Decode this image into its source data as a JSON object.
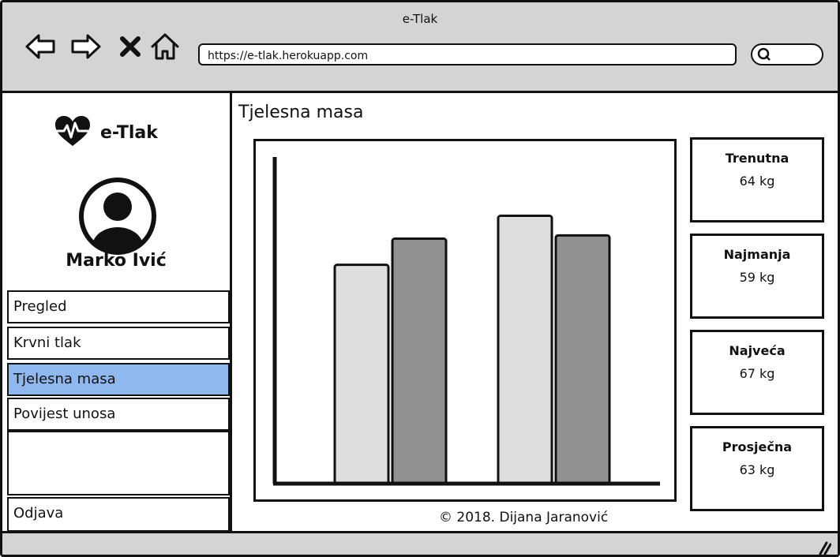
{
  "window": {
    "title": "e-Tlak"
  },
  "browser": {
    "url": "https://e-tlak.herokuapp.com",
    "icons": [
      "back-arrow-icon",
      "forward-arrow-icon",
      "close-icon",
      "home-icon",
      "search-icon"
    ]
  },
  "sidebar": {
    "brand": "e-Tlak",
    "user_name": "Marko Ivić",
    "items": [
      {
        "label": "Pregled",
        "active": false
      },
      {
        "label": "Krvni tlak",
        "active": false
      },
      {
        "label": "Tjelesna masa",
        "active": true
      },
      {
        "label": "Povijest unosa",
        "active": false
      }
    ],
    "logout": "Odjava"
  },
  "main": {
    "title": "Tjelesna masa",
    "stats": [
      {
        "label": "Trenutna",
        "value": "64 kg"
      },
      {
        "label": "Najmanja",
        "value": "59 kg"
      },
      {
        "label": "Najveća",
        "value": "67 kg"
      },
      {
        "label": "Prosječna",
        "value": "63 kg"
      }
    ],
    "footer": "© 2018. Dijana Jaranović"
  },
  "colors": {
    "active_menu": "#8fb8ee",
    "chrome": "#d4d4d4",
    "bar_light": "#dedede",
    "bar_dark": "#929292"
  },
  "chart_data": {
    "type": "bar",
    "categories": [
      "",
      ""
    ],
    "series": [
      {
        "values": [
          67,
          82
        ]
      },
      {
        "values": [
          75,
          76
        ]
      }
    ],
    "ylim": [
      0,
      100
    ],
    "grid": false,
    "legend": "none"
  }
}
